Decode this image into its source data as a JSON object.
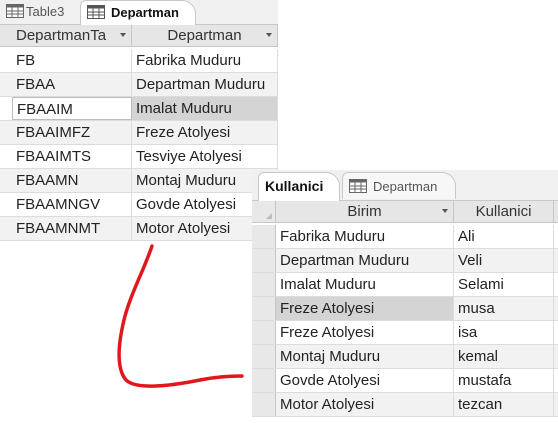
{
  "window1": {
    "tabs": [
      {
        "label": "Table3",
        "active": false
      },
      {
        "label": "Departman",
        "active": true
      }
    ],
    "columns": [
      "DepartmanTa",
      "Departman"
    ],
    "rows": [
      [
        "FB",
        "Fabrika Muduru"
      ],
      [
        "FBAA",
        "Departman Muduru"
      ],
      [
        "FBAAIM",
        "Imalat Muduru"
      ],
      [
        "FBAAIMFZ",
        "Freze Atolyesi"
      ],
      [
        "FBAAIMTS",
        "Tesviye Atolyesi"
      ],
      [
        "FBAAMN",
        "Montaj Muduru"
      ],
      [
        "FBAAMNGV",
        "Govde Atolyesi"
      ],
      [
        "FBAAMNMT",
        "Motor Atolyesi"
      ]
    ]
  },
  "window2": {
    "tabs": [
      {
        "label": "Kullanici",
        "active": true
      },
      {
        "label": "Departman",
        "active": false
      }
    ],
    "columns": [
      "Birim",
      "Kullanici"
    ],
    "rows": [
      [
        "Fabrika Muduru",
        "Ali"
      ],
      [
        "Departman Muduru",
        "Veli"
      ],
      [
        "Imalat Muduru",
        "Selami"
      ],
      [
        "Freze Atolyesi",
        "musa"
      ],
      [
        "Freze Atolyesi",
        "isa"
      ],
      [
        "Montaj Muduru",
        "kemal"
      ],
      [
        "Govde Atolyesi",
        "mustafa"
      ],
      [
        "Motor Atolyesi",
        "tezcan"
      ]
    ]
  },
  "icons": {
    "table": "table-icon",
    "dropdown": "dropdown-arrow-icon"
  },
  "colors": {
    "annotation_stroke": "#e0181e",
    "selected_cell": "#d4d4d4",
    "alt_row": "#f2f2f2"
  }
}
